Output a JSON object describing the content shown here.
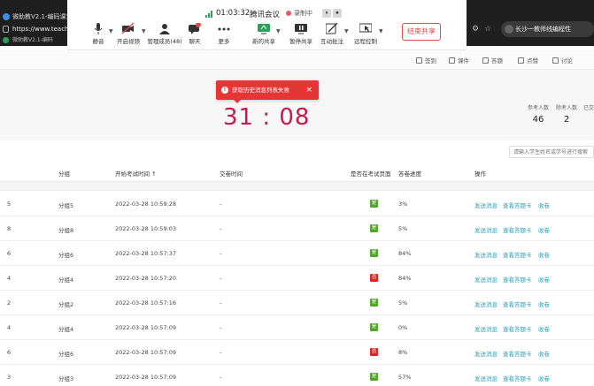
{
  "browser": {
    "tab_title": "微助教V2.1-编码课堂好帮",
    "url": "https://www.teache",
    "bookmark": "微助教V2.1-编码",
    "profile_name": "长沙一教师线编程性"
  },
  "meeting": {
    "time": "01:03:32",
    "app_name": "腾讯会议",
    "recording_label": "录制中",
    "pause_icon": "⏸",
    "stop_icon": "⏹",
    "tools": [
      {
        "label": "静音",
        "icon": "microphone-icon"
      },
      {
        "label": "开启视频",
        "icon": "camera-off-icon"
      },
      {
        "label": "管理成员(48)",
        "icon": "members-icon"
      },
      {
        "label": "聊天",
        "icon": "chat-icon",
        "badge": "2"
      },
      {
        "label": "更多",
        "icon": "more-icon"
      },
      {
        "label": "新的共享",
        "icon": "screen-share-icon"
      },
      {
        "label": "暂停共享",
        "icon": "pause-share-icon"
      },
      {
        "label": "互动批注",
        "icon": "annotate-icon"
      },
      {
        "label": "远程控制",
        "icon": "remote-control-icon"
      }
    ],
    "end_share_label": "结束共享"
  },
  "page": {
    "tabs": [
      {
        "label": "签到"
      },
      {
        "label": "课件"
      },
      {
        "label": "答题"
      },
      {
        "label": "点赞"
      },
      {
        "label": "讨论"
      }
    ],
    "toast_message": "获取历史消息列表失败",
    "toast_close": "×",
    "timer": "31 : 08",
    "stats": [
      {
        "label": "参考人数",
        "value": "46"
      },
      {
        "label": "除考人数",
        "value": "2"
      },
      {
        "label": "已交",
        "value": ""
      }
    ],
    "search_placeholder": "请输入学生姓名或学号进行搜索"
  },
  "table": {
    "headers": [
      "分组",
      "开始考试时间 ↑",
      "交卷时间",
      "是否在考试页面",
      "答卷进度",
      "操作"
    ],
    "actions": [
      "发送消息",
      "查看答题卡",
      "收卷"
    ],
    "rows": [
      {
        "lead": "5",
        "group": "分组5",
        "start": "2022-03-28 10:59:28",
        "submit": "-",
        "on_page": "是",
        "on_page_color": "#52a32a",
        "progress": "3%"
      },
      {
        "lead": "8",
        "group": "分组8",
        "start": "2022-03-28 10:59:03",
        "submit": "-",
        "on_page": "是",
        "on_page_color": "#52a32a",
        "progress": "5%"
      },
      {
        "lead": "6",
        "group": "分组6",
        "start": "2022-03-28 10:57:37",
        "submit": "-",
        "on_page": "是",
        "on_page_color": "#52a32a",
        "progress": "84%"
      },
      {
        "lead": "4",
        "group": "分组4",
        "start": "2022-03-28 10:57:20",
        "submit": "-",
        "on_page": "否",
        "on_page_color": "#e02424",
        "progress": "84%"
      },
      {
        "lead": "2",
        "group": "分组2",
        "start": "2022-03-28 10:57:16",
        "submit": "-",
        "on_page": "是",
        "on_page_color": "#52a32a",
        "progress": "5%"
      },
      {
        "lead": "4",
        "group": "分组4",
        "start": "2022-03-28 10:57:09",
        "submit": "-",
        "on_page": "是",
        "on_page_color": "#52a32a",
        "progress": "0%"
      },
      {
        "lead": "6",
        "group": "分组6",
        "start": "2022-03-28 10:57:09",
        "submit": "-",
        "on_page": "否",
        "on_page_color": "#e02424",
        "progress": "8%"
      },
      {
        "lead": "3",
        "group": "分组3",
        "start": "2022-03-28 10:57:09",
        "submit": "-",
        "on_page": "是",
        "on_page_color": "#52a32a",
        "progress": "57%"
      }
    ]
  }
}
